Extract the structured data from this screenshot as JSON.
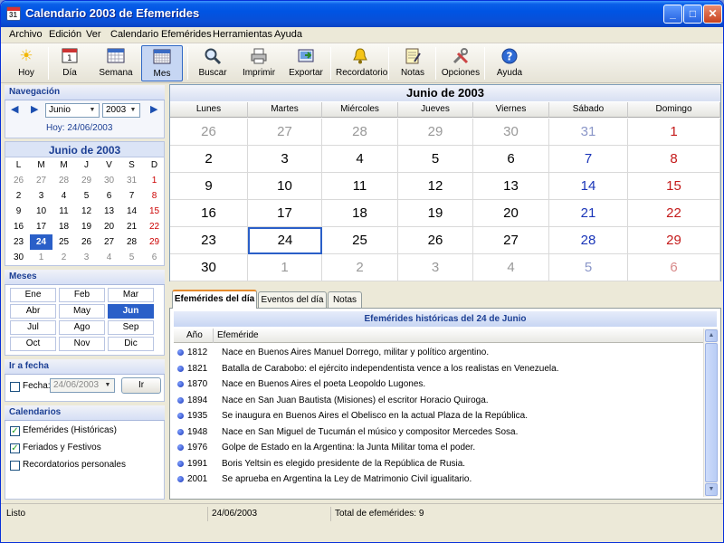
{
  "window": {
    "title": "Calendario 2003 de Efemerides"
  },
  "menu": [
    "Archivo",
    "Edición",
    "Ver",
    "Calendario",
    "Efemérides",
    "Herramientas",
    "Ayuda"
  ],
  "toolbar": [
    {
      "label": "Hoy",
      "icon": "sun-icon"
    },
    {
      "label": "Día",
      "icon": "day-icon"
    },
    {
      "label": "Semana",
      "icon": "week-icon"
    },
    {
      "label": "Mes",
      "icon": "month-icon",
      "active": true
    },
    {
      "label": "Buscar",
      "icon": "search-icon"
    },
    {
      "label": "Imprimir",
      "icon": "printer-icon"
    },
    {
      "label": "Exportar",
      "icon": "export-icon"
    },
    {
      "label": "Recordatorio",
      "icon": "bell-icon"
    },
    {
      "label": "Notas",
      "icon": "notes-icon"
    },
    {
      "label": "Opciones",
      "icon": "tools-icon"
    },
    {
      "label": "Ayuda",
      "icon": "help-icon"
    }
  ],
  "navigation": {
    "title": "Navegación",
    "month_value": "Junio",
    "year_value": "2003",
    "today": "Hoy: 24/06/2003"
  },
  "mini_calendar": {
    "title": "Junio de 2003",
    "dows": [
      "L",
      "M",
      "M",
      "J",
      "V",
      "S",
      "D"
    ],
    "weeks": [
      [
        "26",
        "27",
        "28",
        "29",
        "30",
        "31",
        "1"
      ],
      [
        "2",
        "3",
        "4",
        "5",
        "6",
        "7",
        "8"
      ],
      [
        "9",
        "10",
        "11",
        "12",
        "13",
        "14",
        "15"
      ],
      [
        "16",
        "17",
        "18",
        "19",
        "20",
        "21",
        "22"
      ],
      [
        "23",
        "24",
        "25",
        "26",
        "27",
        "28",
        "29"
      ],
      [
        "30",
        "1",
        "2",
        "3",
        "4",
        "5",
        "6"
      ]
    ],
    "selected": "24"
  },
  "months": {
    "title": "Meses",
    "items": [
      "Ene",
      "Feb",
      "Mar",
      "Abr",
      "May",
      "Jun",
      "Jul",
      "Ago",
      "Sep",
      "Oct",
      "Nov",
      "Dic"
    ],
    "selected": "Jun"
  },
  "goto": {
    "title": "Ir a fecha",
    "label": "Fecha:",
    "value": "24/06/2003",
    "button": "Ir"
  },
  "calendars": {
    "title": "Calendarios",
    "items": [
      {
        "label": "Efemérides (Históricas)",
        "checked": true
      },
      {
        "label": "Feriados y Festivos",
        "checked": true
      },
      {
        "label": "Recordatorios personales",
        "checked": false
      }
    ]
  },
  "main": {
    "title": "Junio de 2003",
    "dows": [
      "Lunes",
      "Martes",
      "Miércoles",
      "Jueves",
      "Viernes",
      "Sábado",
      "Domingo"
    ],
    "weeks": [
      [
        "26",
        "27",
        "28",
        "29",
        "30",
        "31",
        "1"
      ],
      [
        "2",
        "3",
        "4",
        "5",
        "6",
        "7",
        "8"
      ],
      [
        "9",
        "10",
        "11",
        "12",
        "13",
        "14",
        "15"
      ],
      [
        "16",
        "17",
        "18",
        "19",
        "20",
        "21",
        "22"
      ],
      [
        "23",
        "24",
        "25",
        "26",
        "27",
        "28",
        "29"
      ],
      [
        "30",
        "1",
        "2",
        "3",
        "4",
        "5",
        "6"
      ]
    ],
    "today": "24"
  },
  "tabs": [
    "Efemérides del día",
    "Eventos del día",
    "Notas"
  ],
  "efemerides": {
    "title": "Efemérides históricas del 24 de Junio",
    "col_year": "Año",
    "col_text": "Efeméride",
    "rows": [
      {
        "year": "1812",
        "text": "Nace en Buenos Aires Manuel Dorrego, militar y político argentino."
      },
      {
        "year": "1821",
        "text": "Batalla de Carabobo: el ejército independentista vence a los realistas en Venezuela."
      },
      {
        "year": "1870",
        "text": "Nace en Buenos Aires el poeta Leopoldo Lugones."
      },
      {
        "year": "1894",
        "text": "Nace en San Juan Bautista (Misiones) el escritor Horacio Quiroga."
      },
      {
        "year": "1935",
        "text": "Se inaugura en Buenos Aires el Obelisco en la actual Plaza de la República."
      },
      {
        "year": "1948",
        "text": "Nace en San Miguel de Tucumán el músico y compositor Mercedes Sosa."
      },
      {
        "year": "1976",
        "text": "Golpe de Estado en la Argentina: la Junta Militar toma el poder."
      },
      {
        "year": "1991",
        "text": "Boris Yeltsin es elegido presidente de la República de Rusia."
      },
      {
        "year": "2001",
        "text": "Se aprueba en Argentina la Ley de Matrimonio Civil igualitario."
      }
    ]
  },
  "status": {
    "state": "Listo",
    "date": "24/06/2003",
    "count": "Total de efemérides: 9"
  }
}
